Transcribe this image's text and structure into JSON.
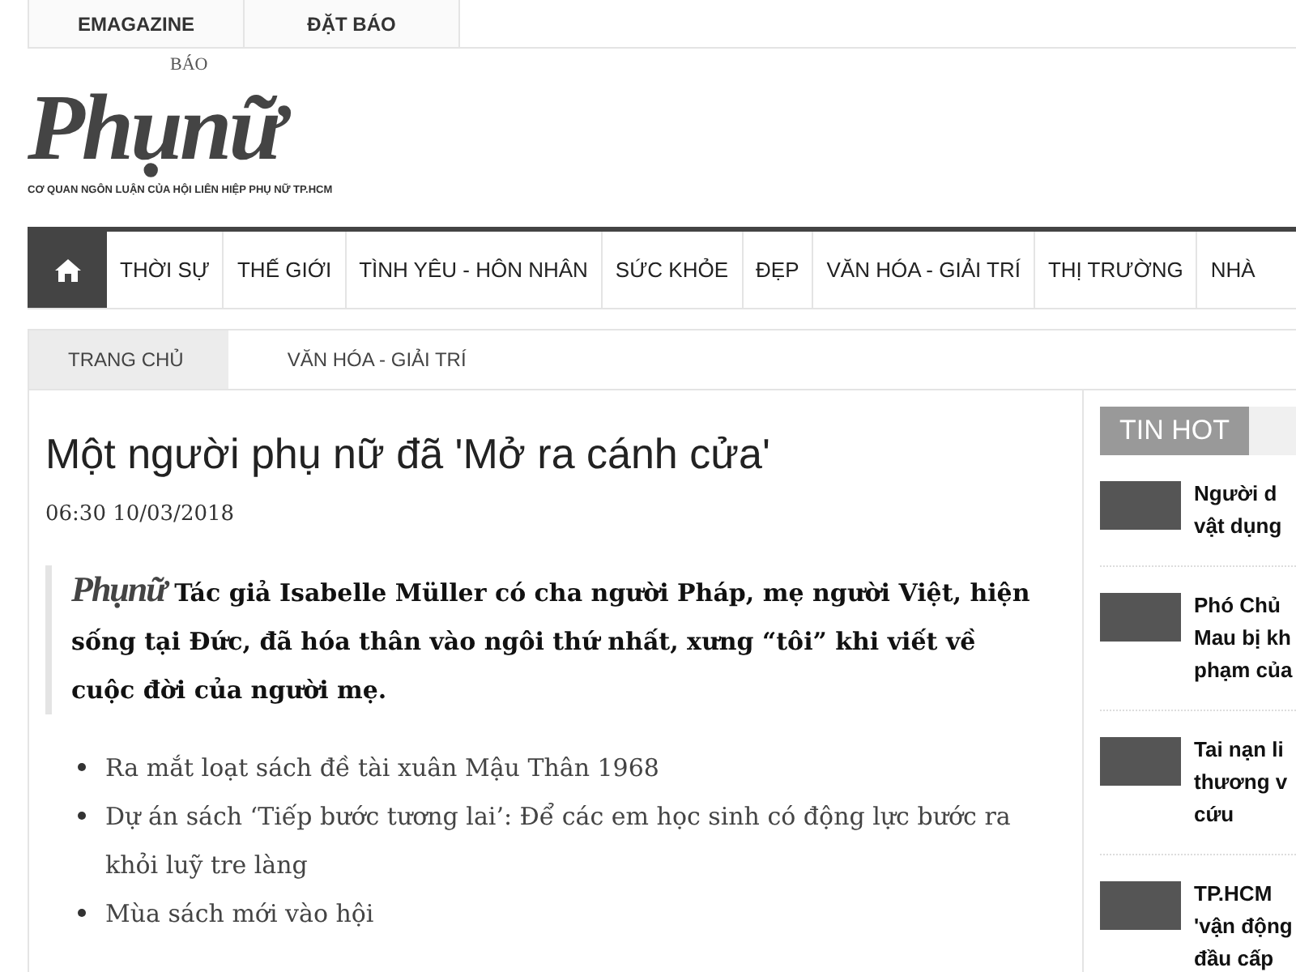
{
  "top_links": [
    "EMAGAZINE",
    "ĐẶT BÁO"
  ],
  "logo": {
    "small": "BÁO",
    "name": "Phụnữ",
    "tagline": "CƠ QUAN NGÔN LUẬN CỦA HỘI LIÊN HIỆP PHỤ NỮ TP.HCM"
  },
  "nav": [
    "THỜI SỰ",
    "THẾ GIỚI",
    "TÌNH YÊU - HÔN NHÂN",
    "SỨC KHỎE",
    "ĐẸP",
    "VĂN HÓA - GIẢI TRÍ",
    "THỊ TRƯỜNG",
    "NHÀ"
  ],
  "breadcrumb": [
    "TRANG CHỦ",
    "VĂN HÓA - GIẢI TRÍ"
  ],
  "article": {
    "title": "Một người phụ nữ đã 'Mở ra cánh cửa'",
    "time": "06:30 10/03/2018",
    "sapo_logo": "Phụnữ",
    "sapo": "Tác giả Isabelle Müller có cha người Pháp, mẹ người Việt, hiện sống tại Đức, đã hóa thân vào ngôi thứ nhất, xưng “tôi” khi viết về cuộc đời của người mẹ.",
    "related": [
      "Ra mắt loạt sách đề tài xuân Mậu Thân 1968",
      "Dự án sách ‘Tiếp bước tương lai’: Để các em học sinh có động lực bước ra khỏi luỹ tre làng",
      "Mùa sách mới vào hội"
    ]
  },
  "sidebar": {
    "heading": "TIN HOT",
    "items": [
      {
        "lines": [
          "Người d",
          "vật dụng"
        ]
      },
      {
        "lines": [
          "Phó Chủ",
          "Mau bị kh",
          "phạm của"
        ]
      },
      {
        "lines": [
          "Tai nạn li",
          "thương v",
          "cứu"
        ]
      },
      {
        "lines": [
          "TP.HCM",
          "'vận động",
          "đầu cấp"
        ]
      }
    ]
  }
}
